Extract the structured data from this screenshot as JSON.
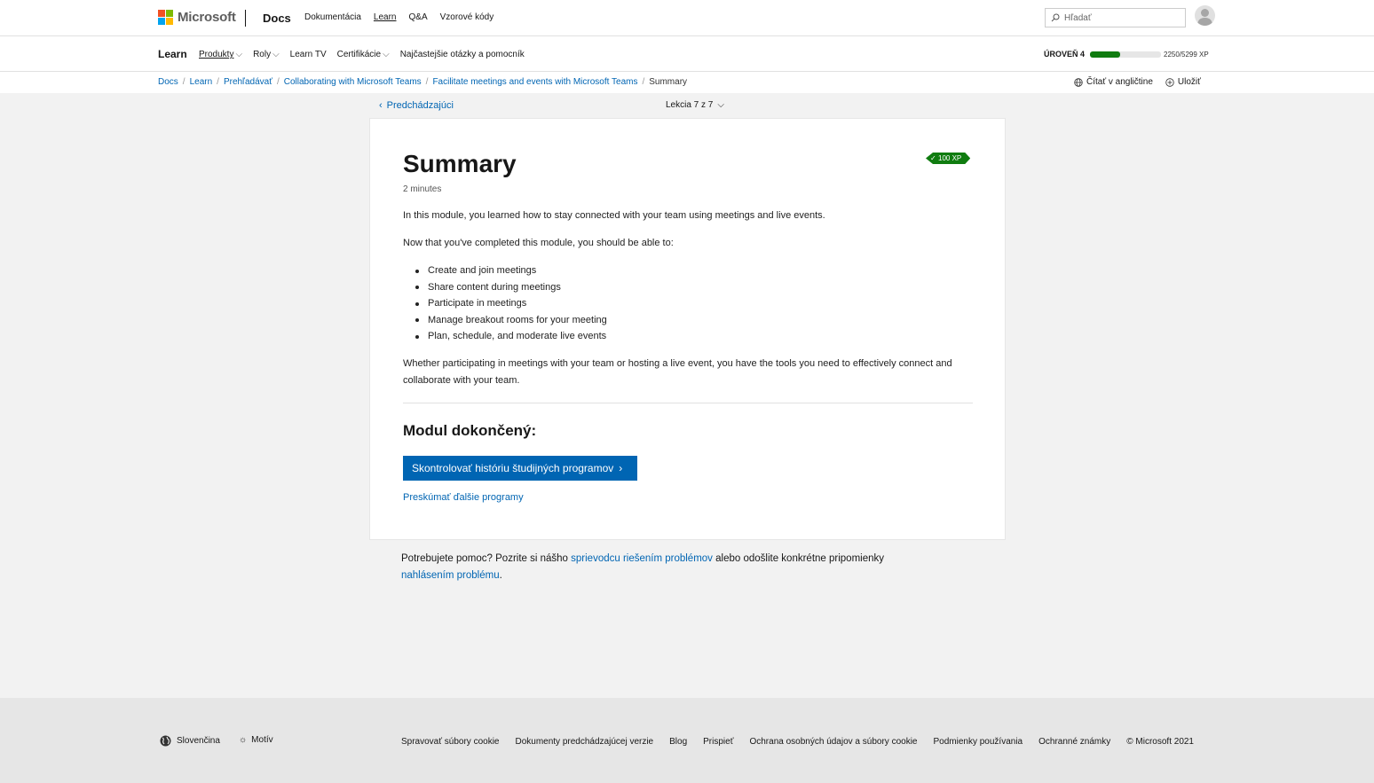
{
  "header": {
    "logo_text": "Microsoft",
    "docs_label": "Docs",
    "nav": [
      "Dokumentácia",
      "Learn",
      "Q&A",
      "Vzorové kódy"
    ],
    "search_placeholder": "Hľadať"
  },
  "subnav": {
    "brand": "Learn",
    "items": [
      "Produkty",
      "Roly",
      "Learn TV",
      "Certifikácie",
      "Najčastejšie otázky a pomocník"
    ],
    "level_label": "ÚROVEŇ 4",
    "level_progress": 0.43,
    "xp_text": "2250/5299 XP"
  },
  "breadcrumb": {
    "items": [
      "Docs",
      "Learn",
      "Prehľadávať",
      "Collaborating with Microsoft Teams",
      "Facilitate meetings and events with Microsoft Teams",
      "Summary"
    ],
    "read_english": "Čítať v angličtine",
    "save": "Uložiť"
  },
  "lesson_nav": {
    "previous": "Predchádzajúci",
    "lesson": "Lekcia 7 z 7"
  },
  "content": {
    "title": "Summary",
    "duration": "2 minutes",
    "xp_badge": "100 XP",
    "intro": "In this module, you learned how to stay connected with your team using meetings and live events.",
    "lead": "Now that you've completed this module, you should be able to:",
    "bullets": [
      "Create and join meetings",
      "Share content during meetings",
      "Participate in meetings",
      "Manage breakout rooms for your meeting",
      "Plan, schedule, and moderate live events"
    ],
    "closing": "Whether participating in meetings with your team or hosting a live event, you have the tools you need to effectively connect and collaborate with your team.",
    "module_done": "Modul dokončený:",
    "history_button": "Skontrolovať históriu študijných programov",
    "explore_link": "Preskúmať ďalšie programy"
  },
  "help": {
    "text1": "Potrebujete pomoc? Pozrite si nášho ",
    "link1": "sprievodcu riešením problémov",
    "text2": " alebo odošlite konkrétne pripomienky ",
    "link2": "nahlásením problému",
    "text3": "."
  },
  "footer": {
    "language": "Slovenčina",
    "theme": "Motív",
    "links": [
      "Spravovať súbory cookie",
      "Dokumenty predchádzajúcej verzie",
      "Blog",
      "Prispieť",
      "Ochrana osobných údajov a súbory cookie",
      "Podmienky používania",
      "Ochranné známky",
      "© Microsoft 2021"
    ]
  },
  "colors": {
    "accent": "#0065b3",
    "success": "#107c10"
  }
}
